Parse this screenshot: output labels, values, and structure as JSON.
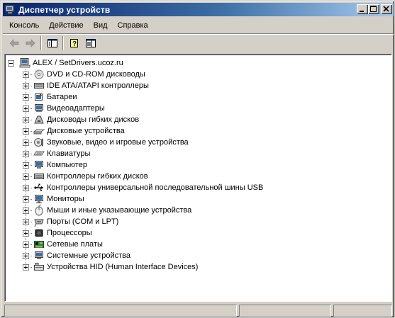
{
  "window": {
    "title": "Диспетчер устройств",
    "title_color": "#0a246a"
  },
  "menu": [
    {
      "label": "Консоль"
    },
    {
      "label": "Действие"
    },
    {
      "label": "Вид"
    },
    {
      "label": "Справка"
    }
  ],
  "toolbar": {
    "buttons": [
      "back-icon",
      "forward-icon",
      "show-hide-tree-icon",
      "help-icon",
      "properties-icon"
    ]
  },
  "tree": {
    "root": {
      "label": "ALEX / SetDrivers.ucoz.ru",
      "icon": "computer-icon"
    },
    "items": [
      {
        "label": "DVD и CD-ROM дисководы",
        "icon": "cdrom-icon"
      },
      {
        "label": "IDE ATA/ATAPI контроллеры",
        "icon": "ide-controller-icon"
      },
      {
        "label": "Батареи",
        "icon": "battery-icon"
      },
      {
        "label": "Видеоадаптеры",
        "icon": "display-adapter-icon"
      },
      {
        "label": "Дисководы гибких дисков",
        "icon": "floppy-drive-icon"
      },
      {
        "label": "Дисковые устройства",
        "icon": "disk-drive-icon"
      },
      {
        "label": "Звуковые, видео и игровые устройства",
        "icon": "sound-icon"
      },
      {
        "label": "Клавиатуры",
        "icon": "keyboard-icon"
      },
      {
        "label": "Компьютер",
        "icon": "computer-small-icon"
      },
      {
        "label": "Контроллеры гибких дисков",
        "icon": "floppy-controller-icon"
      },
      {
        "label": "Контроллеры универсальной последовательной шины USB",
        "icon": "usb-icon"
      },
      {
        "label": "Мониторы",
        "icon": "monitor-icon"
      },
      {
        "label": "Мыши и иные указывающие устройства",
        "icon": "mouse-icon"
      },
      {
        "label": "Порты (COM и LPT)",
        "icon": "port-icon"
      },
      {
        "label": "Процессоры",
        "icon": "processor-icon"
      },
      {
        "label": "Сетевые платы",
        "icon": "network-card-icon"
      },
      {
        "label": "Системные устройства",
        "icon": "system-device-icon"
      },
      {
        "label": "Устройства HID (Human Interface Devices)",
        "icon": "hid-icon"
      }
    ]
  },
  "statusbar": {
    "cells": [
      "",
      "",
      ""
    ]
  }
}
